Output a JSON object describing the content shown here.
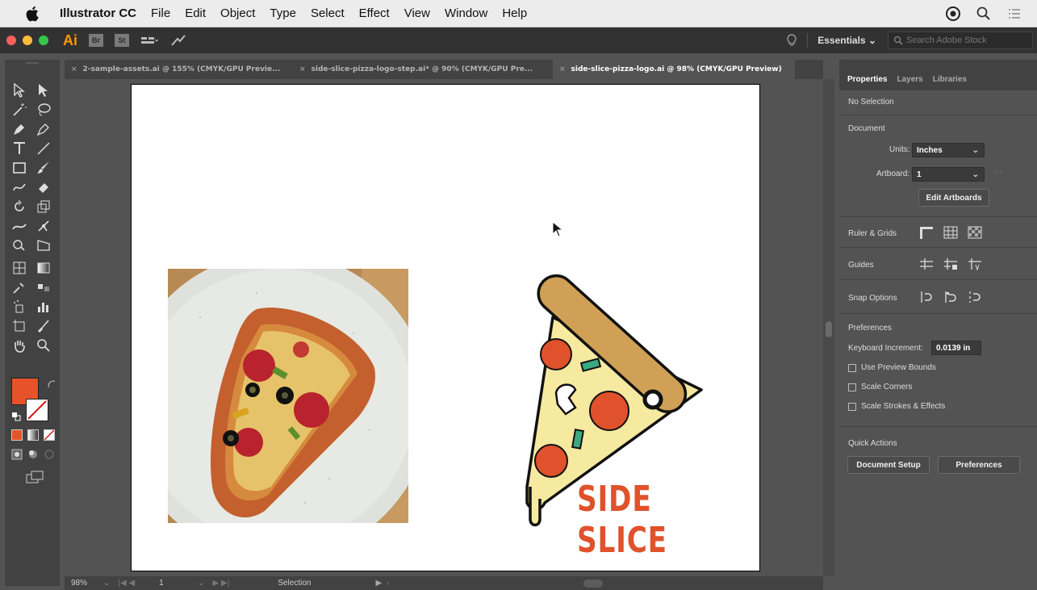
{
  "menubar": {
    "app_name": "Illustrator CC",
    "items": [
      "File",
      "Edit",
      "Object",
      "Type",
      "Select",
      "Effect",
      "View",
      "Window",
      "Help"
    ]
  },
  "appbar": {
    "logo": "Ai",
    "bridge": "Br",
    "stock": "St",
    "workspace": "Essentials",
    "search_placeholder": "Search Adobe Stock"
  },
  "tabs": [
    {
      "label": "2-sample-assets.ai @ 155% (CMYK/GPU Previe..."
    },
    {
      "label": "side-slice-pizza-logo-step.ai* @ 90% (CMYK/GPU Pre..."
    },
    {
      "label": "side-slice-pizza-logo.ai @ 98% (CMYK/GPU Preview)"
    }
  ],
  "canvas": {
    "logo_text": "SIDE SLICE"
  },
  "statusbar": {
    "zoom": "98%",
    "artboard_number": "1",
    "status": "Selection"
  },
  "panel": {
    "tabs": [
      "Properties",
      "Layers",
      "Libraries"
    ],
    "selection": "No Selection",
    "document_heading": "Document",
    "units_label": "Units:",
    "units_value": "Inches",
    "artboard_label": "Artboard:",
    "artboard_value": "1",
    "edit_artboards": "Edit Artboards",
    "ruler_grids": "Ruler & Grids",
    "guides": "Guides",
    "snap_options": "Snap Options",
    "preferences_heading": "Preferences",
    "keyboard_increment_label": "Keyboard Increment:",
    "keyboard_increment_value": "0.0139 in",
    "use_preview_bounds": "Use Preview Bounds",
    "scale_corners": "Scale Corners",
    "scale_strokes": "Scale Strokes & Effects",
    "quick_actions": "Quick Actions",
    "document_setup": "Document Setup",
    "preferences_button": "Preferences"
  },
  "colors": {
    "fill": "#e8522a",
    "accent": "#ff9a00",
    "logo_red": "#e0522b",
    "crust": "#cfa055",
    "cheese": "#f6e9a0",
    "green": "#3aa982"
  }
}
